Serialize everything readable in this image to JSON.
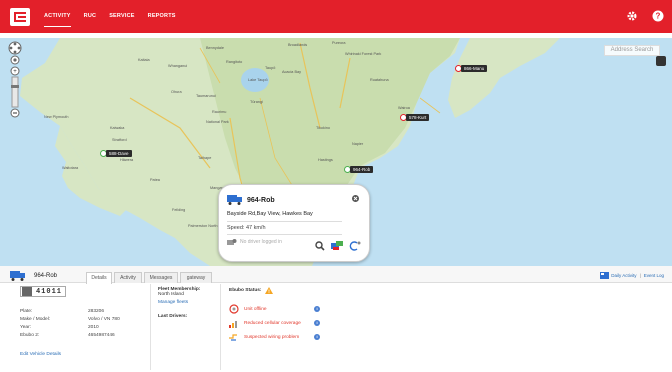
{
  "header": {
    "nav": [
      "ACTIVITY",
      "RUC",
      "SERVICE",
      "REPORTS"
    ],
    "active_nav": "ACTIVITY",
    "icons": [
      "gear-icon",
      "help-icon"
    ]
  },
  "map": {
    "search_label": "Address Search",
    "place_labels": [
      "Whanganui",
      "Bennydale",
      "Rangitoto",
      "Broadlands",
      "Pureora",
      "Whirinaki Forest Park",
      "Taupō",
      "Lake Taupō",
      "Acacia Bay",
      "Tūrangi",
      "Ruatahuna",
      "Kaitaia",
      "Ohura",
      "Taumarunui",
      "Raurimu",
      "National Park",
      "New Plymouth",
      "Stratford",
      "Hāwera",
      "Taihape",
      "Mangaweka",
      "Feilding",
      "Palmerston North",
      "Napier",
      "Hastings",
      "Wairoa",
      "Kaiwaka",
      "Patea",
      "Waitotara",
      "Tikokino",
      "Dannevirke"
    ],
    "markers": [
      {
        "label": "866-Manu",
        "color": "#e3202a"
      },
      {
        "label": "578-Kurt",
        "color": "#e3202a"
      },
      {
        "label": "588-Dave",
        "color": "#4caf50"
      },
      {
        "label": "964-Rob",
        "color": "#4caf50"
      }
    ]
  },
  "popup": {
    "vehicle": "964-Rob",
    "address": "Bayside Rd,Bay View, Hawkes Bay",
    "speed": "Speed: 47 km/h",
    "driver": "No driver logged in"
  },
  "panel": {
    "vehicle": "964-Rob",
    "tabs": [
      "Details",
      "Activity",
      "Messages",
      "gateway"
    ],
    "active_tab": "Details",
    "links": [
      "Daily Activity",
      "Event Log"
    ],
    "odometer": "41011",
    "specs": [
      {
        "key": "Plate:",
        "value": "283206"
      },
      {
        "key": "Make / Model:",
        "value": "Volvo / VN 780"
      },
      {
        "key": "Year:",
        "value": "2010"
      },
      {
        "key": "Ebubo 2:",
        "value": "4654987446"
      }
    ],
    "edit_link": "Edit Vehicle Details",
    "fleet_membership_label": "Fleet Membership:",
    "fleet_membership_value": "North Island",
    "manage_fleets": "Manage fleets",
    "last_drivers_label": "Last Drivers:",
    "ebubo_status_label": "Ebubo Status:",
    "status_items": [
      {
        "label": "Unit offline",
        "icon": "unit-offline-icon"
      },
      {
        "label": "Reduced cellular coverage",
        "icon": "signal-bars-icon"
      },
      {
        "label": "Suspected wiring problem",
        "icon": "wiring-icon"
      }
    ],
    "colors": {
      "accent": "#e3202a",
      "link": "#2a6db5",
      "alert": "#e1382c",
      "info": "#4a7fd1"
    }
  }
}
